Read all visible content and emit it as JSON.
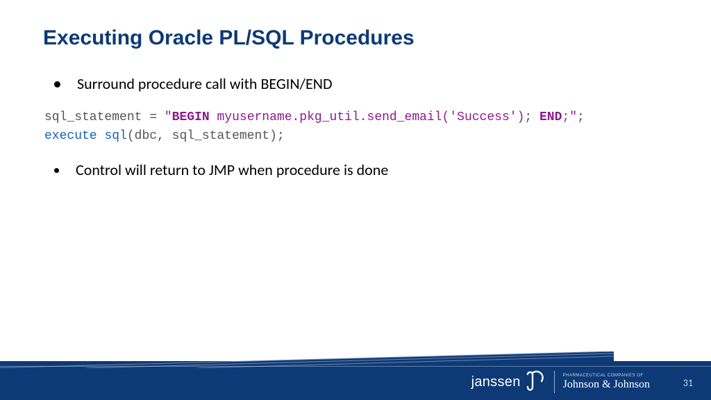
{
  "title": "Executing Oracle PL/SQL Procedures",
  "bullets": {
    "b1": "Surround procedure call with BEGIN/END",
    "b2": "Control will return to JMP when procedure is done"
  },
  "code": {
    "var": "sql_statement",
    "eq": " = ",
    "q1": "\"",
    "kw_begin": "BEGIN",
    "sp1": " ",
    "proc": "myusername.pkg_util.send_email",
    "args": "('Success')",
    "semi1": "; ",
    "kw_end": "END",
    "semi2": ";",
    "q2": "\"",
    "tail": ";",
    "exec1": "execute",
    "sp2": " ",
    "exec2": "sql",
    "exec_args": "(dbc, sql_statement);"
  },
  "brand": {
    "janssen": "janssen",
    "jj_small": "PHARMACEUTICAL COMPANIES OF",
    "jj_script": "Johnson & Johnson"
  },
  "page_number": "31"
}
